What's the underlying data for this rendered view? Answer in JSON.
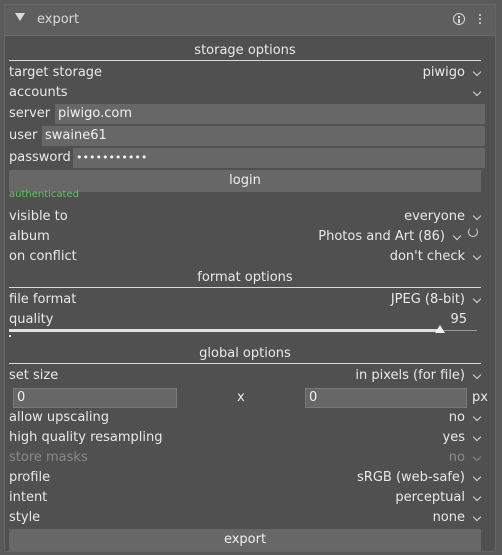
{
  "header": {
    "title": "export",
    "info_icon": "info-icon",
    "menu_icon": "menu-icon"
  },
  "sections": {
    "storage": "storage options",
    "format": "format options",
    "global": "global options"
  },
  "storage": {
    "target_label": "target storage",
    "target_value": "piwigo",
    "accounts_label": "accounts",
    "server_label": "server",
    "server_value": "piwigo.com",
    "user_label": "user",
    "user_value": "swaine61",
    "password_label": "password",
    "password_value": "•••••••••••",
    "login_label": "login",
    "auth_status": "authenticated",
    "visible_label": "visible to",
    "visible_value": "everyone",
    "album_label": "album",
    "album_value": "Photos and Art (86)",
    "conflict_label": "on conflict",
    "conflict_value": "don't check"
  },
  "format": {
    "file_format_label": "file format",
    "file_format_value": "JPEG (8-bit)",
    "quality_label": "quality",
    "quality_value": "95",
    "quality_fraction": 0.95
  },
  "global": {
    "set_size_label": "set size",
    "set_size_value": "in pixels (for file)",
    "width_value": "0",
    "x_label": "x",
    "height_value": "0",
    "unit_label": "px",
    "upscaling_label": "allow upscaling",
    "upscaling_value": "no",
    "hq_label": "high quality resampling",
    "hq_value": "yes",
    "masks_label": "store masks",
    "masks_value": "no",
    "profile_label": "profile",
    "profile_value": "sRGB (web-safe)",
    "intent_label": "intent",
    "intent_value": "perceptual",
    "style_label": "style",
    "style_value": "none",
    "export_label": "export"
  },
  "colors": {
    "authenticated": "#5ec85e",
    "background": "#505050"
  }
}
